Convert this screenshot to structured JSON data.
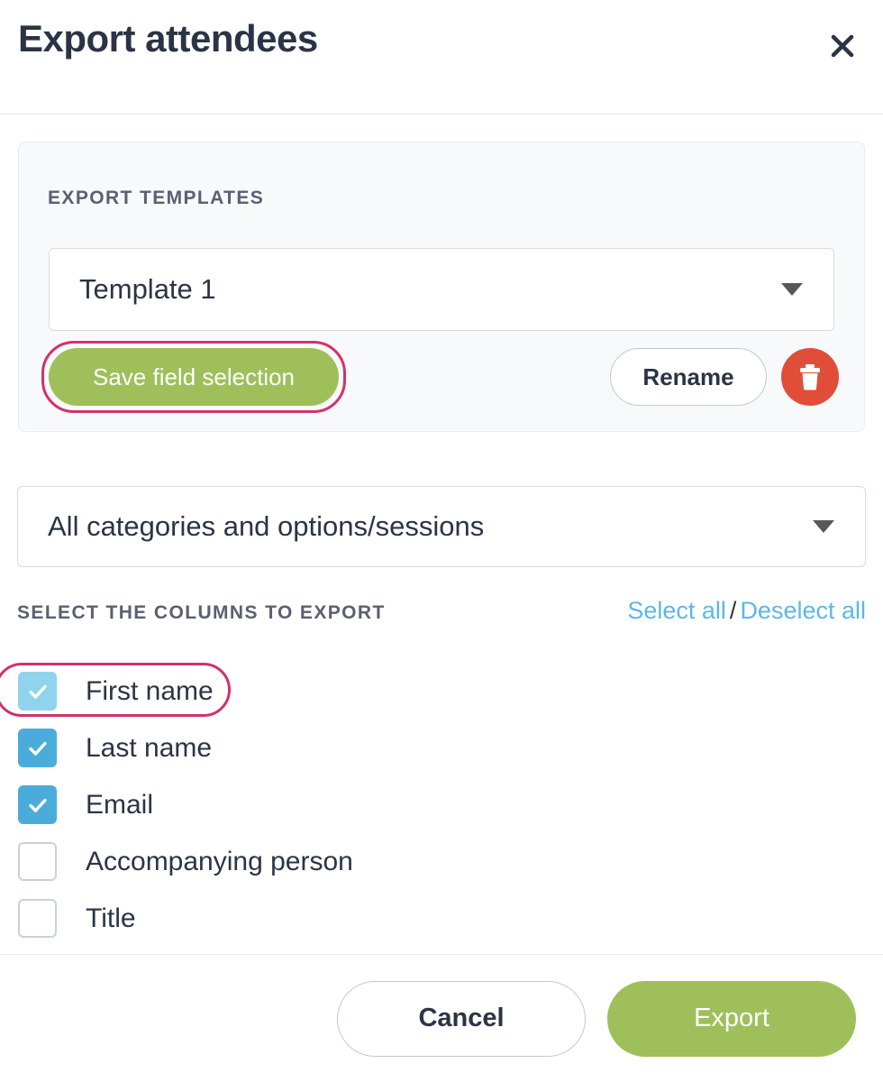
{
  "header": {
    "title": "Export attendees",
    "close_icon": "close-icon"
  },
  "templates_panel": {
    "label": "EXPORT TEMPLATES",
    "template_select": {
      "value": "Template 1",
      "caret_icon": "chevron-down-icon"
    },
    "save_button": "Save field selection",
    "rename_button": "Rename",
    "delete_icon": "trash-icon"
  },
  "category_select": {
    "value": "All categories and options/sessions",
    "caret_icon": "chevron-down-icon"
  },
  "columns": {
    "label": "SELECT THE COLUMNS TO EXPORT",
    "select_all": "Select all",
    "separator": "/",
    "deselect_all": "Deselect all",
    "items": [
      {
        "label": "First name",
        "checked": true,
        "hovered": true,
        "highlighted": true
      },
      {
        "label": "Last name",
        "checked": true,
        "hovered": false,
        "highlighted": false
      },
      {
        "label": "Email",
        "checked": true,
        "hovered": false,
        "highlighted": false
      },
      {
        "label": "Accompanying person",
        "checked": false,
        "hovered": false,
        "highlighted": false
      },
      {
        "label": "Title",
        "checked": false,
        "hovered": false,
        "highlighted": false
      }
    ]
  },
  "footer": {
    "cancel_button": "Cancel",
    "export_button": "Export"
  },
  "colors": {
    "green": "#9fbf5a",
    "pink_highlight": "#d1326b",
    "red_delete": "#e04e39",
    "blue_checkbox": "#4bacdc",
    "blue_checkbox_hover": "#8fd3ec",
    "link_blue": "#5bb8e8",
    "text_dark": "#2b3445",
    "label_gray": "#5a6070",
    "panel_bg": "#f8f9fb"
  }
}
